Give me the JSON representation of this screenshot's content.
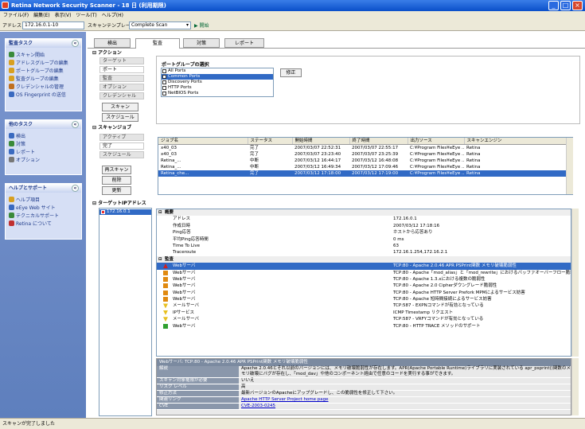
{
  "window": {
    "title": "Retina Network Security Scanner - 18 日 (利用期限)"
  },
  "menu": [
    "ファイル(F)",
    "編集(E)",
    "表示(V)",
    "ツール(T)",
    "ヘルプ(H)"
  ],
  "toolbar": {
    "address_label": "アドレス",
    "address_value": "172.16.0.1-10",
    "template_label": "スキャンテンプレート",
    "template_value": "Complete Scan",
    "start_label": "開始"
  },
  "sidebar": {
    "scan_tasks": {
      "title": "監査タスク",
      "items": [
        "スキャン開始",
        "アドレスグループの編集",
        "ポートグループの編集",
        "監査グループの編集",
        "クレデンシャルの管理",
        "OS Fingerprint の送信"
      ]
    },
    "other_tasks": {
      "title": "他のタスク",
      "items": [
        "検出",
        "対策",
        "レポート",
        "オプション"
      ]
    },
    "help": {
      "title": "ヘルプとサポート",
      "items": [
        "ヘルプ項目",
        "eEye Web サイト",
        "テクニカルサポート",
        "Retina について"
      ]
    }
  },
  "tabs": [
    "検出",
    "監査",
    "対策",
    "レポート"
  ],
  "action": {
    "title": "アクション",
    "subtabs": [
      "ターゲット",
      "ポート",
      "監査",
      "オプション",
      "クレデンシャル"
    ],
    "scan_btn": "スキャン",
    "schedule_btn": "スケジュール",
    "portgroup_title": "ポートグループの選択",
    "edit_btn": "修正",
    "ports": [
      {
        "name": "All Ports",
        "checked": false,
        "selected": false
      },
      {
        "name": "Common Ports",
        "checked": true,
        "selected": true
      },
      {
        "name": "Discovery Ports",
        "checked": false,
        "selected": false
      },
      {
        "name": "HTTP Ports",
        "checked": false,
        "selected": false
      },
      {
        "name": "NetBIOS Ports",
        "checked": false,
        "selected": false
      }
    ]
  },
  "jobs": {
    "title": "スキャンジョブ",
    "subtabs": [
      "アクティブ",
      "完了",
      "スケジュール"
    ],
    "rescan_btn": "再スキャン",
    "delete_btn": "削除",
    "update_btn": "更新",
    "columns": [
      "ジョブ名",
      "ステータス",
      "開始時間",
      "終了時間",
      "出力ソース",
      "スキャンエンジン"
    ],
    "rows": [
      {
        "c": [
          "x40_03",
          "完了",
          "2007/03/07 22:52:31",
          "2007/03/07 22:55:17",
          "C:¥Program Files¥eEye ...",
          "Retina"
        ],
        "sel": false
      },
      {
        "c": [
          "x40_03",
          "完了",
          "2007/03/07 23:23:40",
          "2007/03/07 23:25:39",
          "C:¥Program Files¥eEye ...",
          "Retina"
        ],
        "sel": false
      },
      {
        "c": [
          "Retina_...",
          "中断",
          "2007/03/12 16:44:17",
          "2007/03/12 16:48:08",
          "C:¥Program Files¥eEye ...",
          "Retina"
        ],
        "sel": false
      },
      {
        "c": [
          "Retina_...",
          "中断",
          "2007/03/12 16:49:34",
          "2007/03/12 17:09:46",
          "C:¥Program Files¥eEye ...",
          "Retina"
        ],
        "sel": false
      },
      {
        "c": [
          "Retina_che...",
          "完了",
          "2007/03/12 17:18:00",
          "2007/03/12 17:19:00",
          "C:¥Program Files¥eEye ...",
          "Retina"
        ],
        "sel": true
      }
    ]
  },
  "target": {
    "title": "ターゲットIPアドレス",
    "item": "172.16.0.1"
  },
  "summary": {
    "title": "概要",
    "rows": [
      [
        "アドレス",
        "172.16.0.1"
      ],
      [
        "作成日時",
        "2007/03/12 17:18:16"
      ],
      [
        "Ping応答",
        "ホストから応答あり"
      ],
      [
        "平均Ping応答時間",
        "0 ms"
      ],
      [
        "Time To Live",
        "63"
      ],
      [
        "Traceroute",
        "172.16.1.254,172.16.2.1"
      ]
    ]
  },
  "audit": {
    "title": "監査",
    "rows": [
      {
        "n": "Webサーバ",
        "d": "TCP:80 - Apache 2.0.46 APR PSPrint関数 メモリ破壊脆弱性",
        "sel": true,
        "i": "red"
      },
      {
        "n": "Webサーバ",
        "d": "TCP:80 - Apache「mod_alias」と「mod_rewrite」におけるバッファオーバーフロー脆弱性",
        "sel": false,
        "i": "orange"
      },
      {
        "n": "Webサーバ",
        "d": "TCP:80 - Apache 1.3.xにおける複数の脆弱性",
        "sel": false,
        "i": "orange"
      },
      {
        "n": "Webサーバ",
        "d": "TCP:80 - Apache 2.0 Cipherダウングレード脆弱性",
        "sel": false,
        "i": "orange"
      },
      {
        "n": "Webサーバ",
        "d": "TCP:80 - Apache HTTP Server Prefork MPMによるサービス妨害",
        "sel": false,
        "i": "orange"
      },
      {
        "n": "Webサーバ",
        "d": "TCP:80 - Apache 短時間接続によるサービス妨害",
        "sel": false,
        "i": "orange"
      },
      {
        "n": "メールサーバ",
        "d": "TCP:587 - EXPNコマンドが有効となっている",
        "sel": false,
        "i": "yellow"
      },
      {
        "n": "IPサービス",
        "d": "ICMP Timestamp リクエスト",
        "sel": false,
        "i": "yellow"
      },
      {
        "n": "メールサーバ",
        "d": "TCP:587 - VRFYコマンドが有効となっている",
        "sel": false,
        "i": "yellow"
      },
      {
        "n": "Webサーバ",
        "d": "TCP:80 - HTTP TRACE メソッドのサポート",
        "sel": false,
        "i": "green"
      }
    ]
  },
  "detail": {
    "head": "Webサーバ: TCP:80 - Apache 2.0.46 APR PSPrint関数 メモリ破壊脆弱性",
    "rows": [
      [
        "解説",
        "Apache 2.0.46とそれ以前のバージョンには、メモリ破壊脆弱性が存在します。APR(Apache Portable Runtime)ライブラリに実装されている apr_psprint()関数のメモリ破壊にバグが存在し、「mod_dav」や他のコンポーネント経由で任意のコードを実行する事ができます。"
      ],
      [
        "スキャン対象権限が必要",
        "いいえ"
      ],
      [
        "リスク レベル",
        "高"
      ],
      [
        "修正方法",
        "最新バージョンのApacheにアップグレードし、この脆弱性を修正して下さい。"
      ],
      [
        "関連リンク",
        "Apache HTTP Server Project home page"
      ],
      [
        "CVE",
        "CVE-2003-0245"
      ]
    ]
  },
  "status": "スキャンが完了しました"
}
